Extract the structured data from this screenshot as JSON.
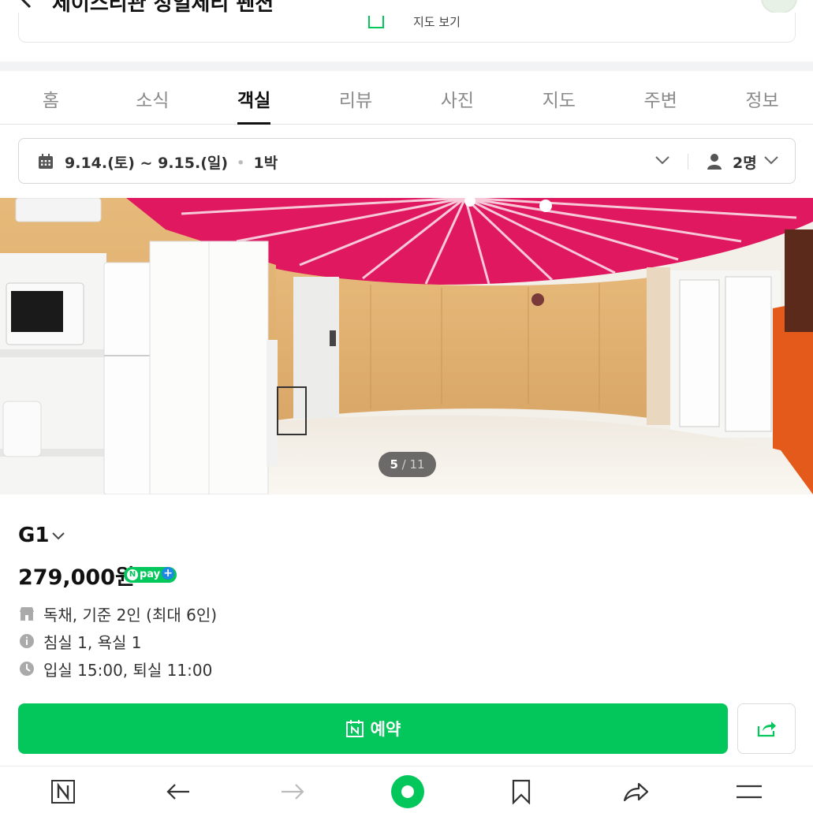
{
  "header": {
    "title": "제이스리관 정일제리 펜션"
  },
  "prev_card": {
    "label": "지도 보기"
  },
  "tabs": [
    {
      "label": "홈"
    },
    {
      "label": "소식"
    },
    {
      "label": "객실",
      "active": true
    },
    {
      "label": "리뷰"
    },
    {
      "label": "사진"
    },
    {
      "label": "지도"
    },
    {
      "label": "주변"
    },
    {
      "label": "정보"
    }
  ],
  "date_selector": {
    "dates": "9.14.(토) ~ 9.15.(일)",
    "separator": "•",
    "nights": "1박",
    "guests": "2명"
  },
  "photo": {
    "current": "5",
    "slash": " / ",
    "total": "11"
  },
  "room": {
    "name": "G1",
    "price": "279,000원",
    "npay_label": "pay",
    "npay_n": "N",
    "npay_plus": "+",
    "info": [
      {
        "icon": "house-icon",
        "text": "독채, 기준 2인 (최대 6인)"
      },
      {
        "icon": "info-icon",
        "text": "침실 1, 욕실 1"
      },
      {
        "icon": "clock-icon",
        "text": "입실 15:00, 퇴실 11:00"
      }
    ]
  },
  "actions": {
    "reserve_label": "예약"
  },
  "colors": {
    "accent": "#03c75a",
    "npay_plus": "#1e88e5",
    "ceiling": "#e0185f"
  }
}
